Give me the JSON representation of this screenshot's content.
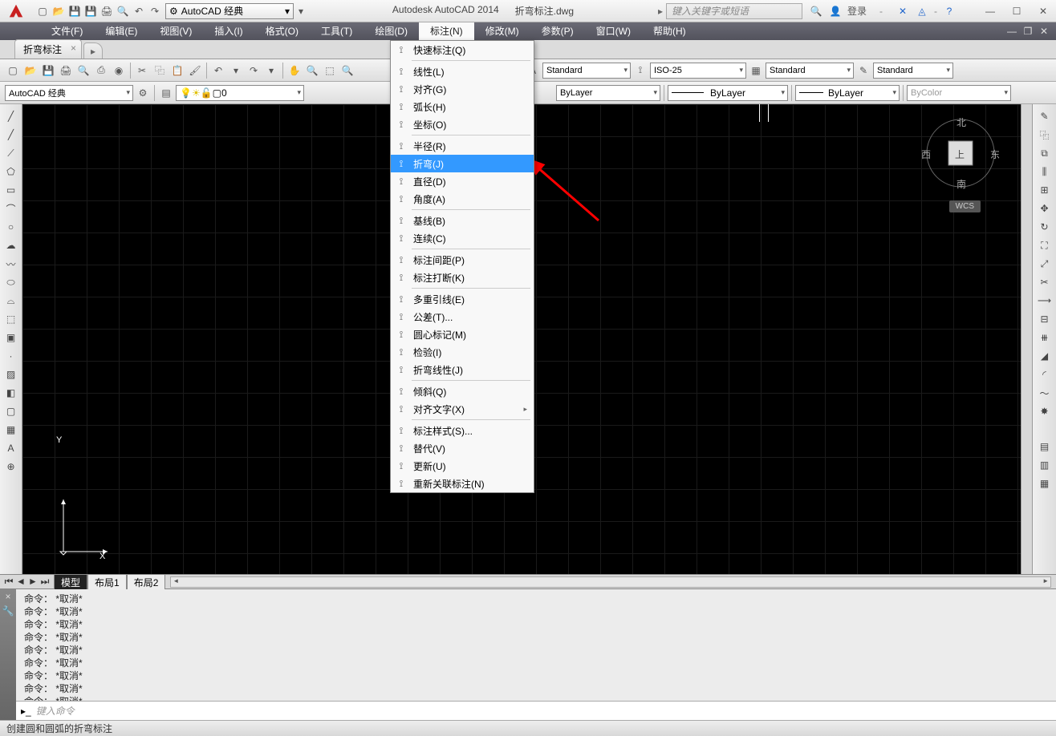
{
  "app_title": "Autodesk AutoCAD 2014",
  "file_name": "折弯标注.dwg",
  "workspace": "AutoCAD 经典",
  "search_placeholder": "键入关键字或短语",
  "login_label": "登录",
  "menus": [
    "文件(F)",
    "编辑(E)",
    "视图(V)",
    "插入(I)",
    "格式(O)",
    "工具(T)",
    "绘图(D)",
    "标注(N)",
    "修改(M)",
    "参数(P)",
    "窗口(W)",
    "帮助(H)"
  ],
  "active_menu_index": 7,
  "file_tab": "折弯标注",
  "toolbar2": {
    "workspace": "AutoCAD 经典",
    "layer": "0",
    "style1": "Standard",
    "dimstyle": "ISO-25",
    "style2": "Standard",
    "style3": "Standard",
    "bylayer1": "ByLayer",
    "bylayer2": "ByLayer",
    "bylayer3": "ByLayer",
    "bycolor": "ByColor"
  },
  "dropdown_items": [
    {
      "label": "快速标注(Q)"
    },
    {
      "sep": true
    },
    {
      "label": "线性(L)"
    },
    {
      "label": "对齐(G)"
    },
    {
      "label": "弧长(H)"
    },
    {
      "label": "坐标(O)"
    },
    {
      "sep": true
    },
    {
      "label": "半径(R)"
    },
    {
      "label": "折弯(J)",
      "highlight": true
    },
    {
      "label": "直径(D)"
    },
    {
      "label": "角度(A)"
    },
    {
      "sep": true
    },
    {
      "label": "基线(B)"
    },
    {
      "label": "连续(C)"
    },
    {
      "sep": true
    },
    {
      "label": "标注间距(P)"
    },
    {
      "label": "标注打断(K)"
    },
    {
      "sep": true
    },
    {
      "label": "多重引线(E)"
    },
    {
      "label": "公差(T)..."
    },
    {
      "label": "圆心标记(M)"
    },
    {
      "label": "检验(I)"
    },
    {
      "label": "折弯线性(J)"
    },
    {
      "sep": true
    },
    {
      "label": "倾斜(Q)"
    },
    {
      "label": "对齐文字(X)",
      "sub": true
    },
    {
      "sep": true
    },
    {
      "label": "标注样式(S)..."
    },
    {
      "label": "替代(V)"
    },
    {
      "label": "更新(U)"
    },
    {
      "label": "重新关联标注(N)"
    }
  ],
  "viewcube": {
    "n": "北",
    "s": "南",
    "e": "东",
    "w": "西",
    "top": "上"
  },
  "wcs": "WCS",
  "ucs": {
    "x": "X",
    "y": "Y"
  },
  "layout_tabs": [
    "模型",
    "布局1",
    "布局2"
  ],
  "cmd_history": [
    "命令： *取消*",
    "命令： *取消*",
    "命令： *取消*",
    "命令： *取消*",
    "命令： *取消*",
    "命令： *取消*",
    "命令： *取消*",
    "命令： *取消*",
    "命令： *取消*"
  ],
  "cmd_placeholder": "键入命令",
  "status_text": "创建圆和圆弧的折弯标注"
}
